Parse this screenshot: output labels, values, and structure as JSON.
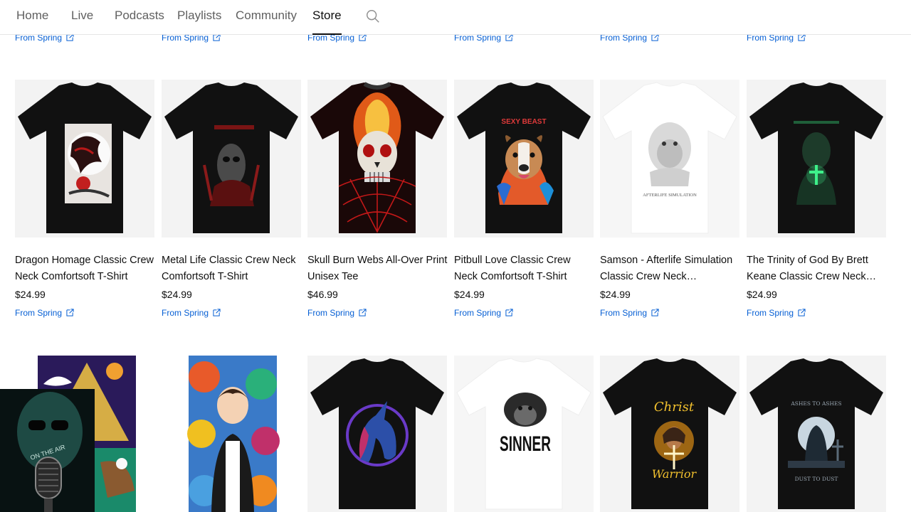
{
  "nav": {
    "tabs": [
      "Home",
      "Live",
      "Podcasts",
      "Playlists",
      "Community",
      "Store"
    ],
    "active": "Store"
  },
  "from_label": "From Spring",
  "row1": [
    {
      "title": "Dragon Homage Classic Crew Neck Comfortsoft T-Shirt",
      "price": "$24.99",
      "from": "From Spring"
    },
    {
      "title": "Metal Life Classic Crew Neck Comfortsoft T-Shirt",
      "price": "$24.99",
      "from": "From Spring"
    },
    {
      "title": "Skull Burn Webs All-Over Print Unisex Tee",
      "price": "$46.99",
      "from": "From Spring"
    },
    {
      "title": "Pitbull Love Classic Crew Neck Comfortsoft T-Shirt",
      "price": "$24.99",
      "from": "From Spring"
    },
    {
      "title": "Samson - Afterlife Simulation Classic Crew Neck Comfortsoft T-Shirt",
      "price": "$24.99",
      "from": "From Spring"
    },
    {
      "title": "The Trinity of God By Brett Keane Classic Crew Neck Comfortsoft T-Shirt",
      "price": "$24.99",
      "from": "From Spring"
    }
  ],
  "shirt_text": {
    "pitbull": "SEXY BEAST",
    "samson": "AFTERLIFE SIMULATION",
    "sinner": "SINNER",
    "christ_top": "Christ",
    "christ_bottom": "Warrior",
    "ashes_top": "ASHES TO ASHES",
    "ashes_bottom": "DUST TO DUST"
  },
  "overlay": {
    "sign": "ON THE AIR"
  },
  "colors": {
    "link": "#065fd4",
    "text": "#0f0f0f",
    "tab_inactive": "#606060"
  }
}
